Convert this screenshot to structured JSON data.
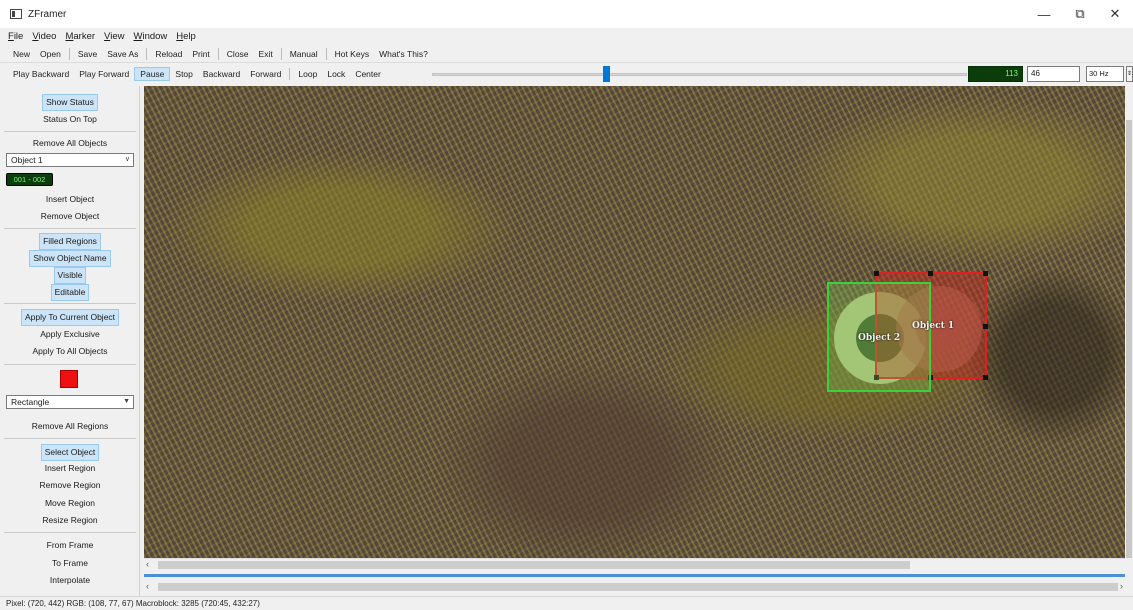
{
  "window": {
    "title": "ZFramer",
    "minimize_glyph": "—",
    "maximize_glyph": "⧉",
    "close_glyph": "✕"
  },
  "menubar": [
    "File",
    "Video",
    "Marker",
    "View",
    "Window",
    "Help"
  ],
  "toolbar_file": [
    "New",
    "Open",
    "Save",
    "Save As",
    "Reload",
    "Print",
    "Close",
    "Exit"
  ],
  "toolbar_help": [
    "Manual",
    "Hot Keys",
    "What's This?"
  ],
  "toolbar_playback": {
    "buttons": [
      "Play Backward",
      "Play Forward",
      "Pause",
      "Stop",
      "Backward",
      "Forward"
    ],
    "active": "Pause",
    "extra": [
      "Loop",
      "Lock",
      "Center"
    ],
    "frame_counter": "113",
    "frame_input": "46",
    "rate": "30 Hz"
  },
  "left_panel": {
    "show_status": "Show Status",
    "status_on_top": "Status On Top",
    "remove_all_objects": "Remove All Objects",
    "object_select": "Object 1",
    "object_range": "001 - 002",
    "insert_object": "Insert Object",
    "remove_object": "Remove Object",
    "filled_regions": "Filled Regions",
    "show_object_name": "Show Object Name",
    "visible": "Visible",
    "editable": "Editable",
    "apply_to_current": "Apply To Current Object",
    "apply_exclusive": "Apply Exclusive",
    "apply_to_all": "Apply To All Objects",
    "region_color": "#ee1111",
    "shape_select": "Rectangle",
    "remove_all_regions": "Remove All Regions",
    "select_object": "Select Object",
    "insert_region": "Insert Region",
    "remove_region": "Remove Region",
    "move_region": "Move Region",
    "resize_region": "Resize Region",
    "from_frame": "From Frame",
    "to_frame": "To Frame",
    "interpolate": "Interpolate"
  },
  "video": {
    "object_1_label": "Object 1",
    "object_2_label": "Object 2"
  },
  "status_bar": "Pixel: (720, 442) RGB: (108, 77, 67) Macroblock: 3285 (720:45, 432:27)"
}
